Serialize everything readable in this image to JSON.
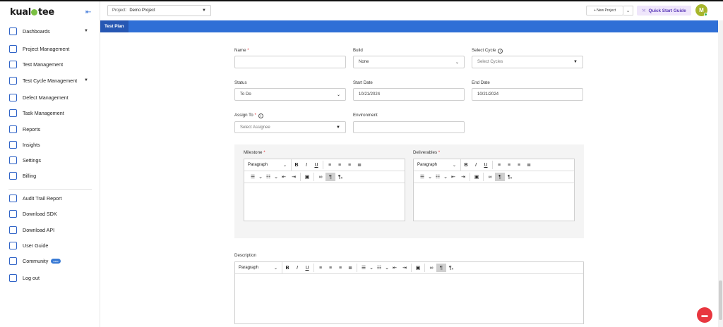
{
  "brand": {
    "logo": "kualitee"
  },
  "sidebar": {
    "items": [
      {
        "label": "Dashboards",
        "icon": "dashboard-icon",
        "caret": "▼"
      },
      {
        "label": "Project Management",
        "icon": "hierarchy-icon",
        "caret": ""
      },
      {
        "label": "Test Management",
        "icon": "test-icon",
        "caret": ""
      },
      {
        "label": "Test Cycle Management",
        "icon": "cycle-icon",
        "caret": "▼"
      },
      {
        "label": "Defect Management",
        "icon": "defect-icon",
        "caret": ""
      },
      {
        "label": "Task Management",
        "icon": "task-icon",
        "caret": ""
      },
      {
        "label": "Reports",
        "icon": "report-icon",
        "caret": ""
      },
      {
        "label": "Insights",
        "icon": "insights-icon",
        "caret": ""
      },
      {
        "label": "Settings",
        "icon": "gear-icon",
        "caret": ""
      },
      {
        "label": "Billing",
        "icon": "billing-icon",
        "caret": ""
      },
      {
        "label": "Audit Trail Report",
        "icon": "audit-icon",
        "caret": ""
      },
      {
        "label": "Download SDK",
        "icon": "download-icon",
        "caret": ""
      },
      {
        "label": "Download API",
        "icon": "api-icon",
        "caret": ""
      },
      {
        "label": "User Guide",
        "icon": "guide-icon",
        "caret": ""
      },
      {
        "label": "Community",
        "icon": "community-icon",
        "caret": ""
      },
      {
        "label": "Log out",
        "icon": "logout-icon",
        "caret": ""
      }
    ],
    "community_badge": "new"
  },
  "header": {
    "project_label": "Project:",
    "project_value": "Demo Project",
    "new_project": "+ New Project",
    "quick_start": "Quick Start Guide",
    "avatar": "M"
  },
  "tabs": {
    "active": "Test Plan"
  },
  "form": {
    "name_label": "Name",
    "build_label": "Build",
    "build_value": "None",
    "cycle_label": "Select Cycle",
    "cycle_placeholder": "Select Cycles",
    "status_label": "Status",
    "status_value": "To Do",
    "start_label": "Start Date",
    "start_value": "10/21/2024",
    "end_label": "End Date",
    "end_value": "10/21/2024",
    "assign_label": "Assign To",
    "assign_placeholder": "Select Assignee",
    "env_label": "Environment",
    "milestone_label": "Milestone",
    "deliverables_label": "Deliverables",
    "description_label": "Description",
    "required_mark": "*",
    "paragraph": "Paragraph"
  },
  "colors": {
    "accent": "#2f6fd6",
    "brand_green": "#7bc043",
    "required": "#e0353b"
  }
}
